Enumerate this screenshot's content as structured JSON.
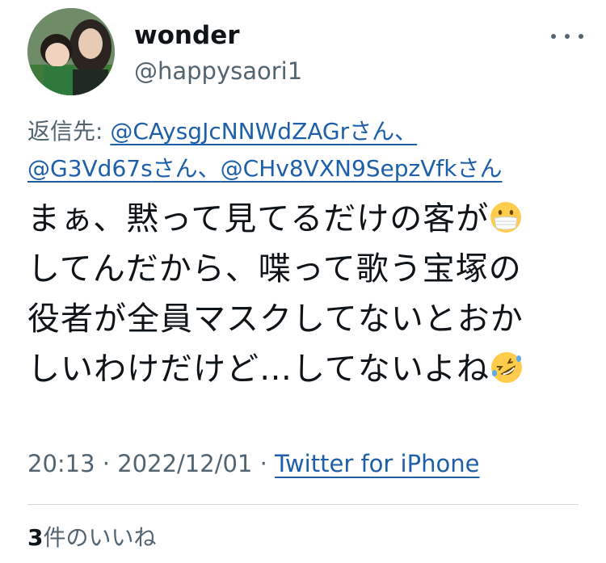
{
  "user": {
    "name": "wonder",
    "handle": "@happysaori1"
  },
  "reply": {
    "prefix": "返信先: ",
    "mentions": [
      {
        "handle": "@CAysgJcNNWdZAGr",
        "suffix": "さん、"
      },
      {
        "handle": "@G3Vd67s",
        "suffix": "さん、"
      },
      {
        "handle": "@CHv8VXN9SepzVfk",
        "suffix": "さん"
      }
    ]
  },
  "tweet": {
    "lines": [
      "まぁ、黙って見てるだけの客が",
      "してんだから、喋って歌う宝塚の",
      "役者が全員マスクしてないとおか",
      "しいわけだけど…してないよね"
    ],
    "emojis": [
      "face-with-medical-mask-icon",
      "rolling-on-floor-laughing-icon"
    ]
  },
  "meta": {
    "time": "20:13",
    "separator": " · ",
    "date": "2022/12/01",
    "source": "Twitter for iPhone"
  },
  "likes": {
    "count": "3",
    "label": "件のいいね"
  }
}
